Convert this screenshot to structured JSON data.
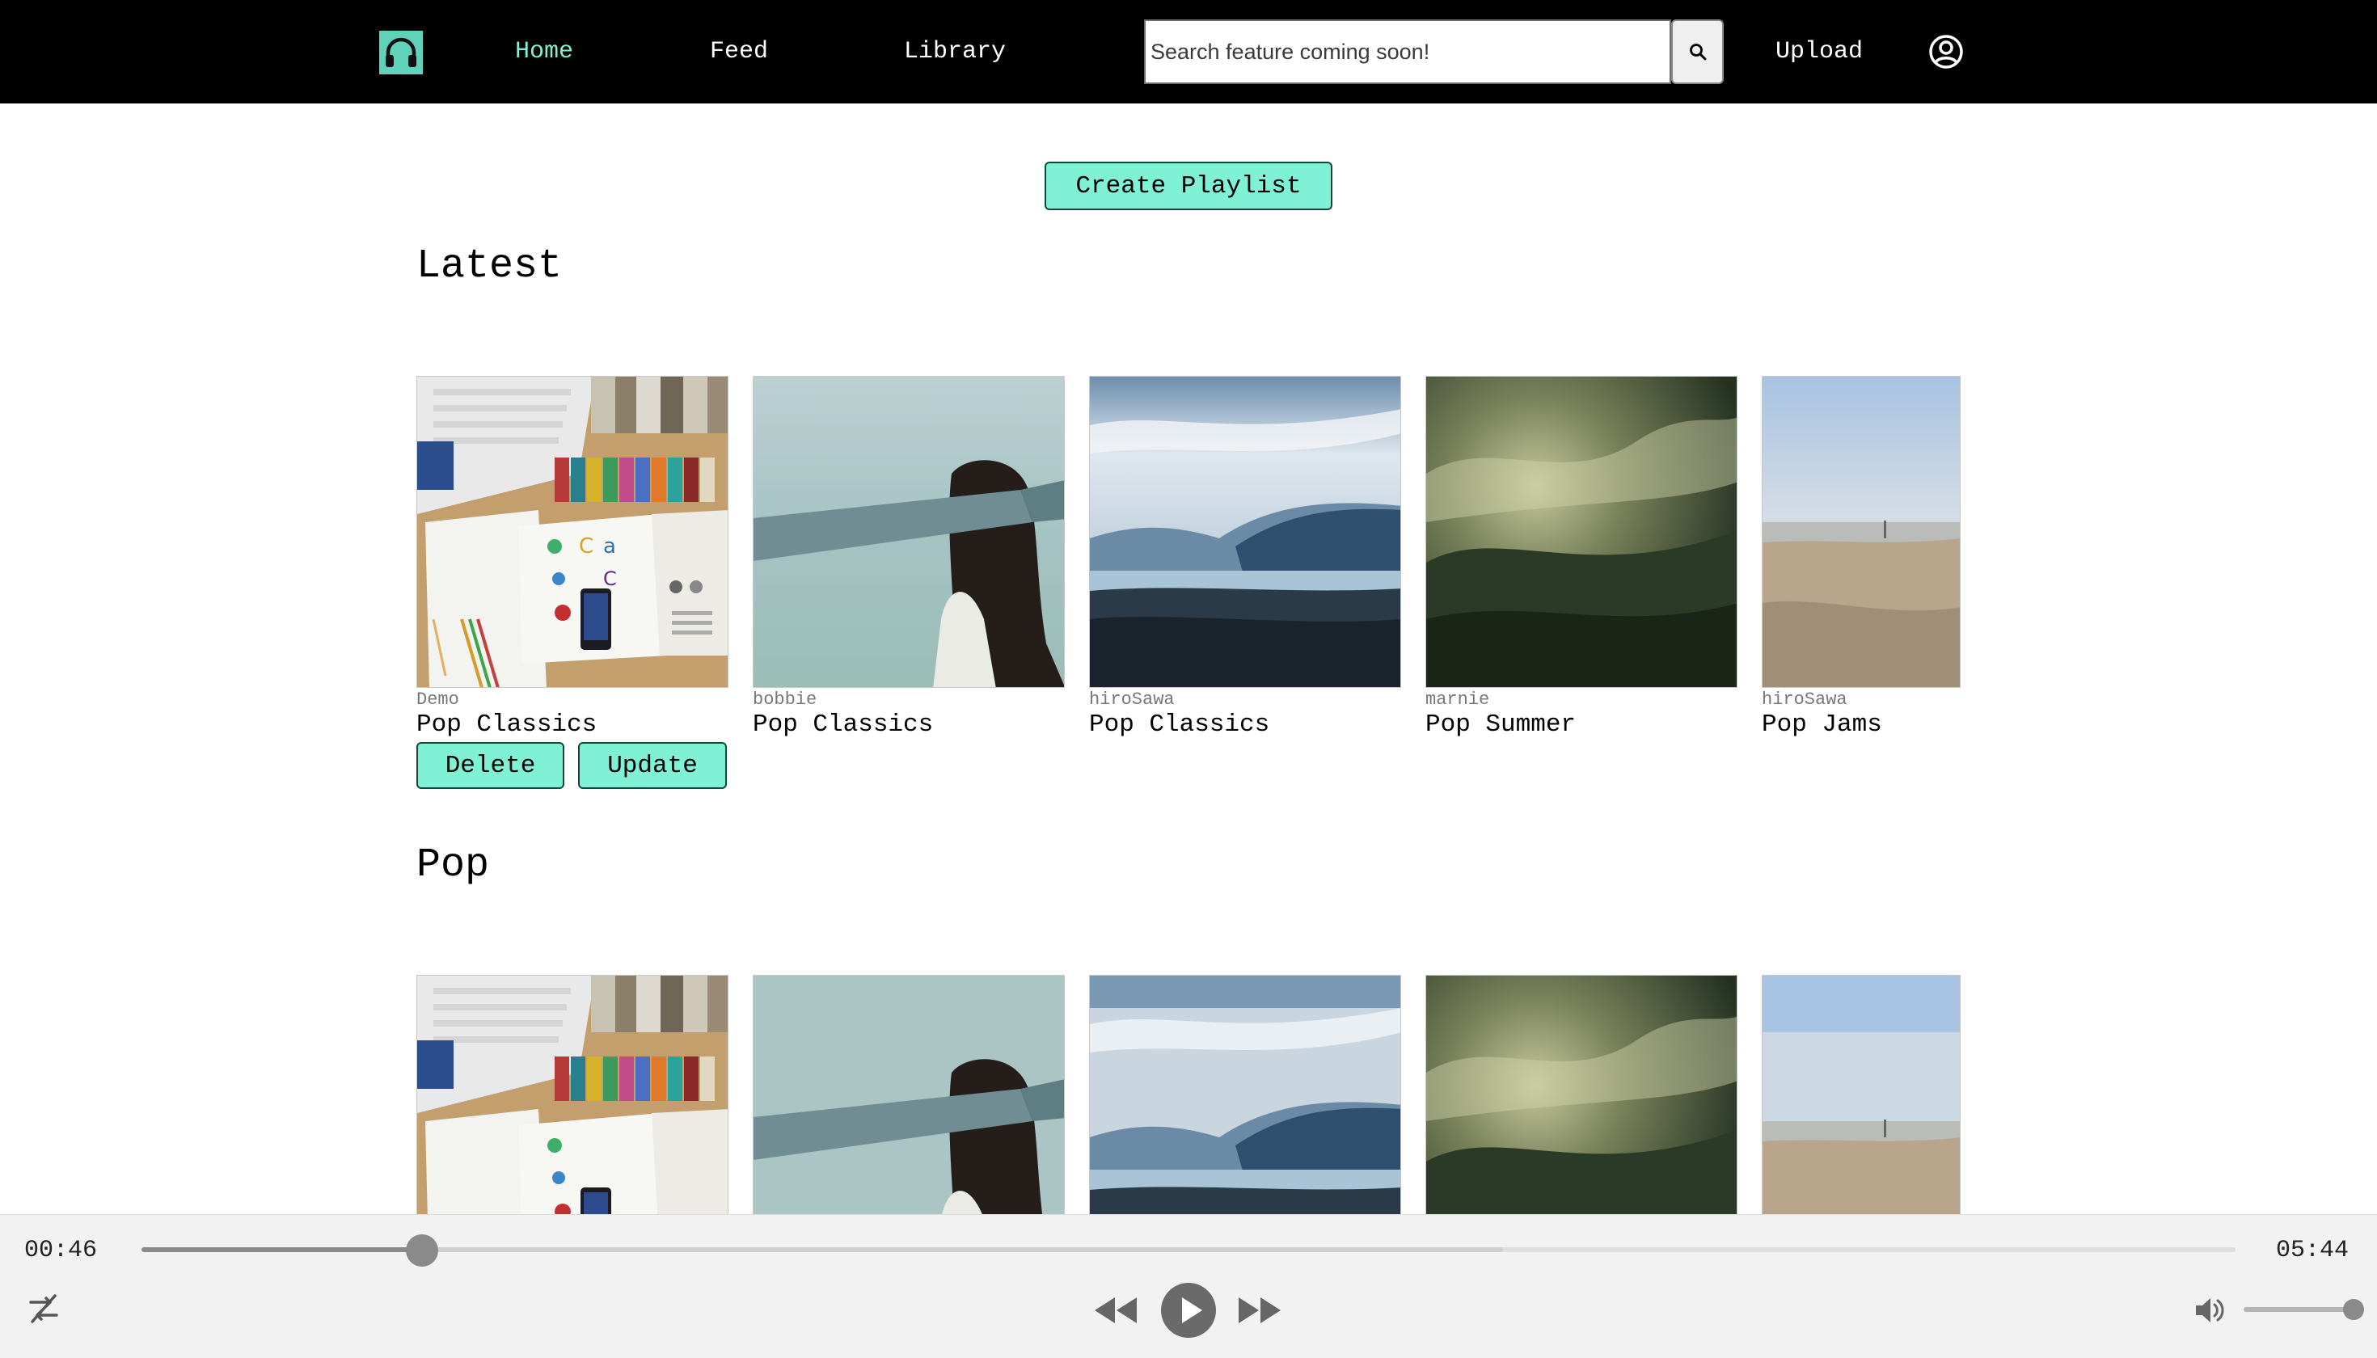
{
  "nav": {
    "logo": "headphones-icon",
    "links": [
      "Home",
      "Feed",
      "Library"
    ],
    "active_link": "Home",
    "search_placeholder": "Search feature coming soon!",
    "search_icon": "search-icon",
    "upload_label": "Upload",
    "profile_icon": "user-circle-icon",
    "accent_color": "#60d2b9",
    "active_color": "#7ff1d5"
  },
  "main": {
    "create_playlist_label": "Create Playlist",
    "sections": [
      {
        "title": "Latest",
        "cards": [
          {
            "creator": "Demo",
            "title": "Pop Classics",
            "image": "desk-flatlay"
          },
          {
            "creator": "bobbie",
            "title": "Pop Classics",
            "image": "blindfolded-woman"
          },
          {
            "creator": "hiroSawa",
            "title": "Pop Classics",
            "image": "mountain-lake"
          },
          {
            "creator": "marnie",
            "title": "Pop Summer",
            "image": "misty-forest"
          },
          {
            "creator": "hiroSawa",
            "title": "Pop Jams",
            "image": "sandy-beach"
          }
        ],
        "owner_actions": {
          "delete_label": "Delete",
          "update_label": "Update"
        }
      },
      {
        "title": "Pop",
        "cards": [
          {
            "image": "desk-flatlay"
          },
          {
            "image": "blindfolded-woman"
          },
          {
            "image": "mountain-lake"
          },
          {
            "image": "misty-forest"
          },
          {
            "image": "sandy-beach"
          }
        ]
      }
    ]
  },
  "player": {
    "current_time": "00:46",
    "duration": "05:44",
    "progress_fraction": 0.134,
    "buffered_fraction": 0.65,
    "volume_fraction": 1.0,
    "icons": {
      "shuffle": "shuffle-off-icon",
      "rewind": "rewind-icon",
      "play": "play-icon",
      "forward": "fast-forward-icon",
      "volume": "volume-icon"
    }
  }
}
